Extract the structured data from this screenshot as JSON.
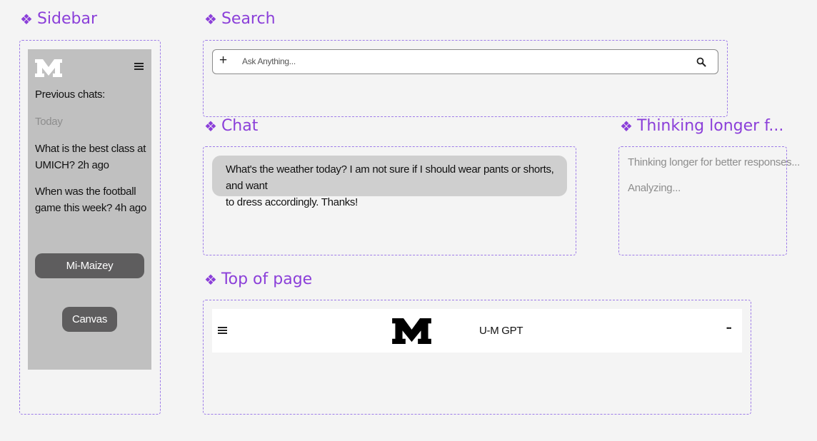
{
  "sections": {
    "sidebar": "Sidebar",
    "search": "Search",
    "chat": "Chat",
    "thinking": "Thinking longer f...",
    "top_of_page": "Top of page"
  },
  "section_glyph": "❖",
  "sidebar": {
    "logo": "M",
    "menu_icon": "≡",
    "previous_chats_label": "Previous chats:",
    "today_label": "Today",
    "chats": [
      {
        "line1": "What is the best class at",
        "line2": "UMICH? 2h ago"
      },
      {
        "line1": "When was the football",
        "line2": "game this week? 4h ago"
      }
    ],
    "mi_maizey_button": "Mi-Maizey",
    "canvas_button": "Canvas"
  },
  "search": {
    "plus_icon": "+",
    "placeholder": "Ask Anything...",
    "search_icon": "search-icon"
  },
  "chat": {
    "message_line1": "What's the weather today? I am not sure if I should wear pants or shorts, and want",
    "message_line2": "to dress accordingly. Thanks!"
  },
  "thinking": {
    "status1": "Thinking longer for better responses...",
    "status2": "Analyzing..."
  },
  "top_bar": {
    "menu_icon": "≡",
    "title": "U-M GPT",
    "more_icon": "•••"
  },
  "colors": {
    "accent": "#8b3fd9",
    "dashed_border": "#9e7ce8",
    "sidebar_bg": "#c0c0c0",
    "button_bg": "#5e5d5e",
    "bubble_bg": "#cfcfcf"
  }
}
